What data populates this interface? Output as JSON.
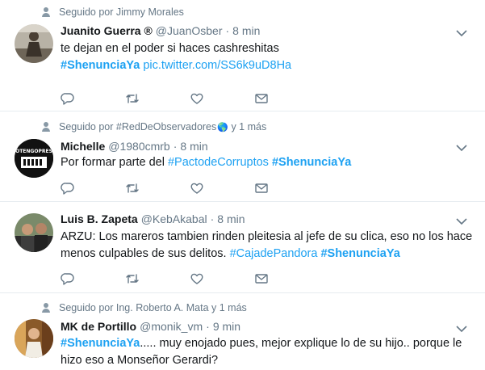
{
  "tweets": [
    {
      "social": "Seguido por Jimmy Morales",
      "name": "Juanito Guerra ®",
      "handle": "@JuanOsber",
      "dot": "·",
      "time": "8 min",
      "line1": "te dejan en el poder si haces cashreshitas",
      "hashtag1": "#ShenunciaYa",
      "link": "pic.twitter.com/SS6k9uD8Ha"
    },
    {
      "social": "Seguido por #RedDeObservadores",
      "social_globe": "🌎",
      "social_more": " y 1 más",
      "name": "Michelle",
      "handle": "@1980cmrb",
      "dot": "·",
      "time": "8 min",
      "text_pre": "Por formar parte del ",
      "hashtag1": "#PactodeCorruptos",
      "hashtag2": "#ShenunciaYa"
    },
    {
      "name": "Luis B. Zapeta",
      "handle": "@KebAkabal",
      "dot": "·",
      "time": "8 min",
      "line1": "ARZU: Los mareros tambien rinden pleitesia al jefe de su clica, eso no los hace",
      "line2_pre": "menos culpables de sus delitos. ",
      "hashtag1": "#CajadePandora",
      "hashtag2": "#ShenunciaYa"
    },
    {
      "social": "Seguido por Ing. Roberto A. Mata y 1 más",
      "name": "MK de Portillo",
      "handle": "@monik_vm",
      "dot": "·",
      "time": "9 min",
      "hashtag1": "#ShenunciaYa",
      "line1_post": "..... muy enojado pues, mejor explique lo de su hijo.. porque le",
      "line2": "hizo eso a Monseñor Gerardi?"
    }
  ],
  "avatar2_text": "OTENGOPRES",
  "colors": {
    "link": "#1da1f2",
    "meta": "#657786",
    "text": "#14171a",
    "divider": "#e6ecf0"
  },
  "icons": [
    "reply-icon",
    "retweet-icon",
    "like-icon",
    "message-icon",
    "chevron-down-icon",
    "person-icon"
  ]
}
